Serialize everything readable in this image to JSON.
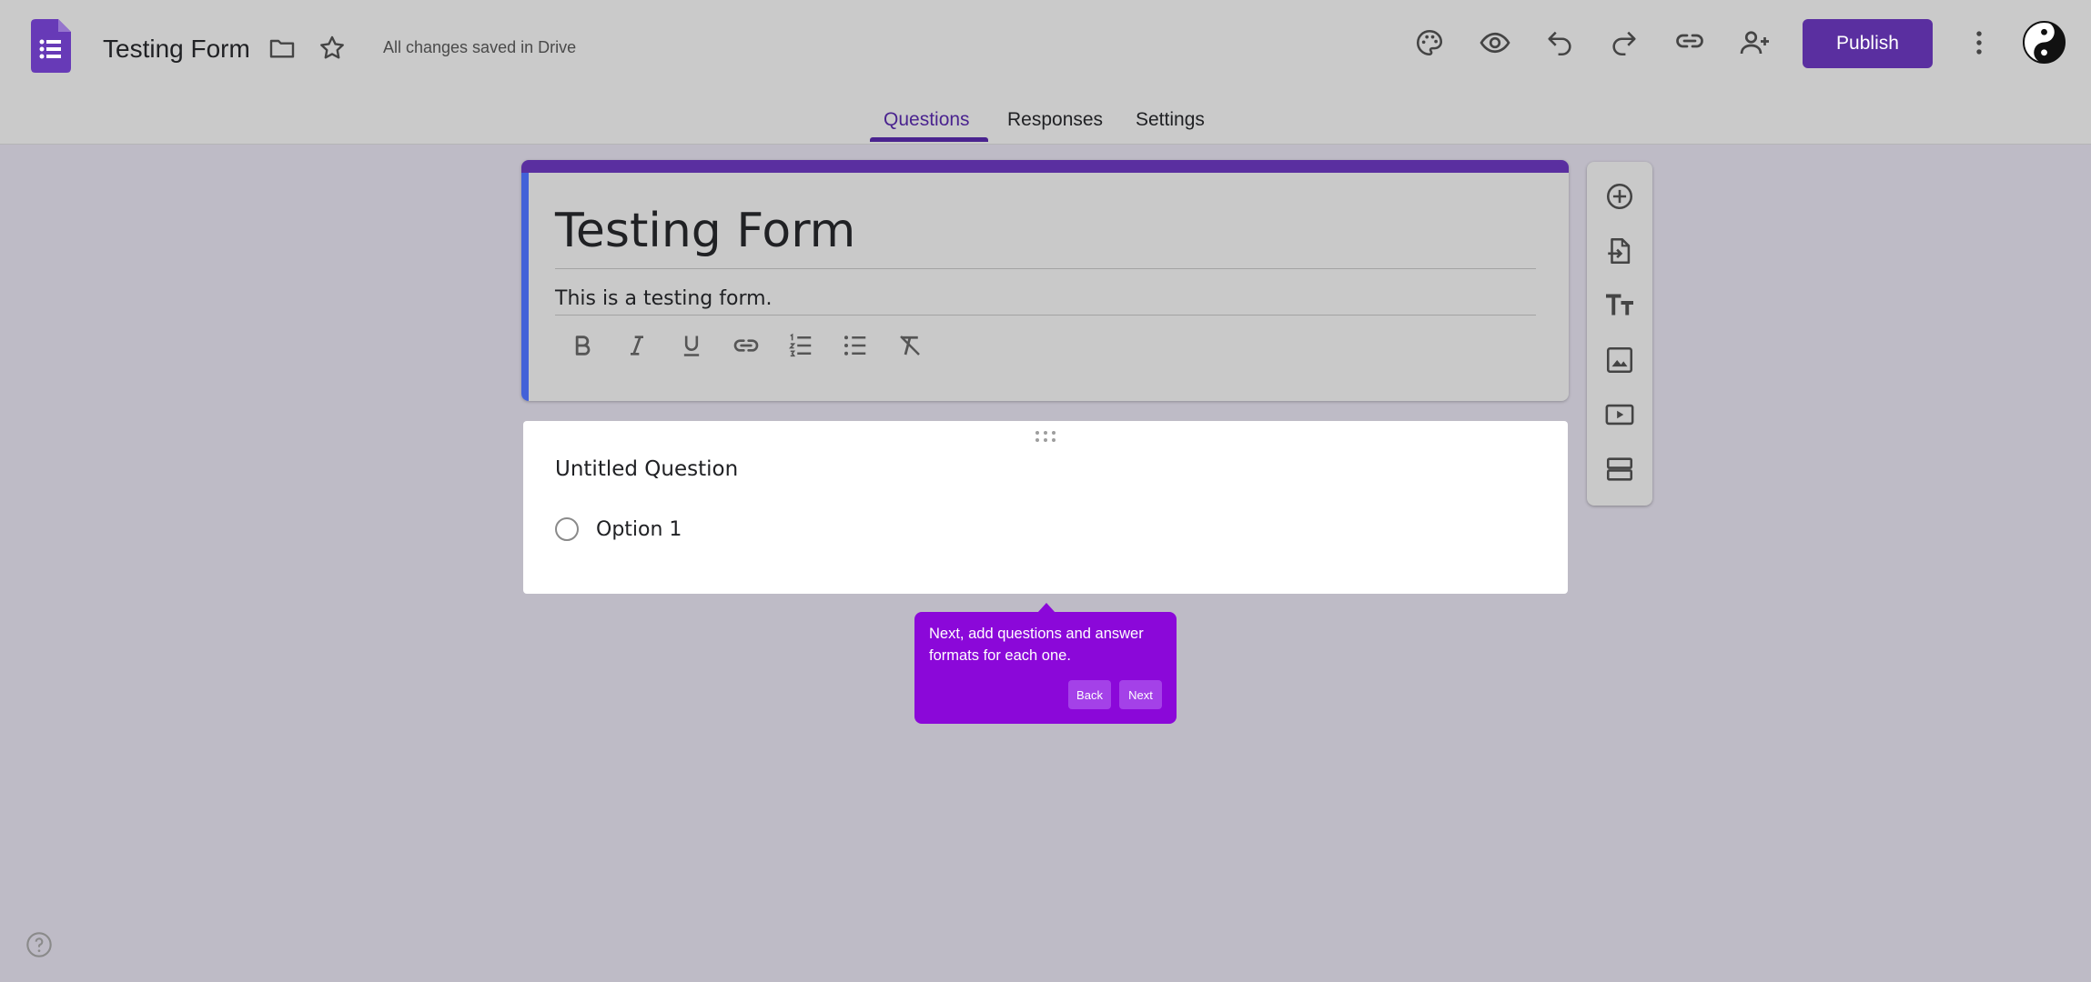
{
  "header": {
    "app_icon": "forms-logo-icon",
    "doc_title": "Testing Form",
    "folder_icon": "folder-icon",
    "star_icon": "star-icon",
    "save_status": "All changes saved in Drive",
    "actions": [
      "palette-icon",
      "preview-eye-icon",
      "undo-icon",
      "redo-icon",
      "link-icon",
      "add-collaborator-icon"
    ],
    "publish_label": "Publish",
    "more_icon": "more-vert-icon",
    "avatar_icon": "yin-yang-avatar"
  },
  "tabs": [
    {
      "label": "Questions",
      "active": true
    },
    {
      "label": "Responses",
      "active": false
    },
    {
      "label": "Settings",
      "active": false
    }
  ],
  "form": {
    "title": "Testing Form",
    "description": "This is a testing form.",
    "format_tools": [
      "bold-icon",
      "italic-icon",
      "underline-icon",
      "insert-link-icon",
      "numbered-list-icon",
      "bulleted-list-icon",
      "clear-formatting-icon"
    ]
  },
  "question": {
    "title": "Untitled Question",
    "options": [
      "Option 1"
    ]
  },
  "side_tools": [
    "add-question-icon",
    "import-questions-icon",
    "add-title-icon",
    "add-image-icon",
    "add-video-icon",
    "add-section-icon"
  ],
  "tooltip": {
    "text": "Next, add questions and answer formats for each one.",
    "back_label": "Back",
    "next_label": "Next"
  },
  "colors": {
    "accent": "#5a2fa0",
    "tab_active": "#4a238f",
    "tooltip_bg": "#8b08d9",
    "title_left_bar": "#4361d8"
  }
}
